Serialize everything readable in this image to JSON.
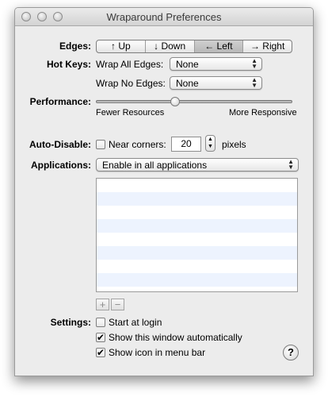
{
  "window": {
    "title": "Wraparound Preferences"
  },
  "edges": {
    "label": "Edges:",
    "segments": [
      "↑ Up",
      "↓ Down",
      "← Left",
      "→ Right"
    ],
    "selected_index": 2
  },
  "hotkeys": {
    "label": "Hot Keys:",
    "wrap_all_label": "Wrap All Edges:",
    "wrap_all_value": "None",
    "wrap_no_label": "Wrap No Edges:",
    "wrap_no_value": "None"
  },
  "performance": {
    "label": "Performance:",
    "min_label": "Fewer Resources",
    "max_label": "More Responsive",
    "value_fraction": 0.4
  },
  "auto_disable": {
    "label": "Auto-Disable:",
    "checkbox_label": "Near corners:",
    "checked": false,
    "value": "20",
    "unit": "pixels"
  },
  "applications": {
    "label": "Applications:",
    "value": "Enable in all applications",
    "add_symbol": "+",
    "remove_symbol": "−"
  },
  "settings": {
    "label": "Settings:",
    "start_at_login": {
      "label": "Start at login",
      "checked": false
    },
    "show_window": {
      "label": "Show this window automatically",
      "checked": true
    },
    "show_icon": {
      "label": "Show icon in menu bar",
      "checked": true
    },
    "help_symbol": "?"
  },
  "check_mark": "✔",
  "popup_arrows": "▲\n▼"
}
